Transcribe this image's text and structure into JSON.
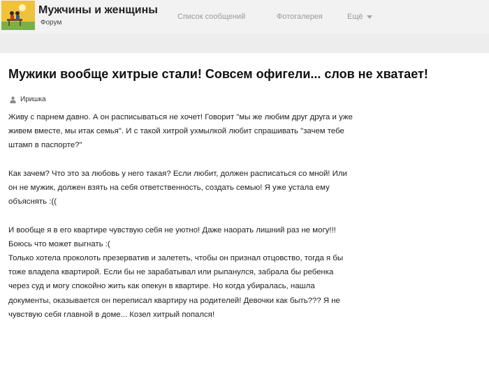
{
  "header": {
    "site_name": "Мужчины и женщины",
    "site_subtitle": "Форум",
    "logo_icon": "forum-logo-icon",
    "nav": {
      "messages": "Список сообщений",
      "gallery": "Фотогалерея",
      "more": "Ещё"
    }
  },
  "post": {
    "title": "Мужики вообще хитрые стали! Совсем офигели... слов не хватает!",
    "author": "Иришка",
    "author_icon": "user-icon",
    "paragraphs": [
      {
        "lines": [
          "Живу с парнем давно. А он расписываться не хочет! Говорит \"мы же любим друг друга и уже",
          "живем вместе, мы итак семья\". И с такой хитрой ухмылкой любит спрашивать \"зачем тебе",
          "штамп в паспорте?\""
        ]
      },
      {
        "lines": [
          "Как зачем? Что это за любовь у него такая? Если любит, должен расписаться со мной! Или",
          "он не мужик, должен взять на себя ответственность, создать семью! Я уже устала ему",
          "объяснять :(("
        ]
      },
      {
        "lines": [
          "И вообще я в его квартире чувствую себя не уютно! Даже наорать лишний раз не могу!!!",
          "Боюсь что может выгнать :(",
          "Только хотела проколоть презерватив и залететь, чтобы он признал отцовство, тогда я бы",
          "тоже владела квартирой. Если бы не зарабатывал или рыпанулся, забрала бы ребенка",
          "через суд и могу спокойно жить как опекун в квартире. Но когда убиралась, нашла",
          "документы, оказывается он переписал квартиру на родителей! Девочки как быть??? Я не",
          "чувствую себя главной в доме... Козел хитрый попался!"
        ]
      }
    ]
  }
}
